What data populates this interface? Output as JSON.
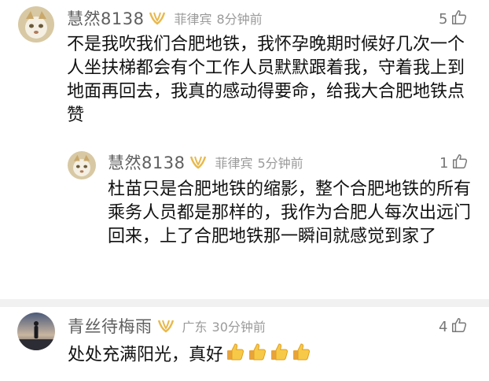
{
  "comments": [
    {
      "username": "慧然8138",
      "location": "菲律宾",
      "time": "8分钟前",
      "likes": "5",
      "text": "不是我吹我们合肥地铁，我怀孕晚期时候好几次一个人坐扶梯都会有个工作人员默默跟着我，守着我上到地面再回去，我真的感动得要命，给我大合肥地铁点赞"
    },
    {
      "username": "慧然8138",
      "location": "菲律宾",
      "time": "5分钟前",
      "likes": "1",
      "text": "杜苗只是合肥地铁的缩影，整个合肥地铁的所有乘务人员都是那样的，我作为合肥人每次出远门回来，上了合肥地铁那一瞬间就感觉到家了"
    },
    {
      "username": "青丝待梅雨",
      "location": "广东",
      "time": "30分钟前",
      "likes": "4",
      "text": "处处充满阳光，真好",
      "emoji": [
        "thumbs-up",
        "thumbs-up",
        "thumbs-up",
        "thumbs-up"
      ]
    }
  ],
  "colors": {
    "badge": "#e8b84a",
    "meta": "#9a9a9a",
    "username": "#5f5f5f"
  }
}
